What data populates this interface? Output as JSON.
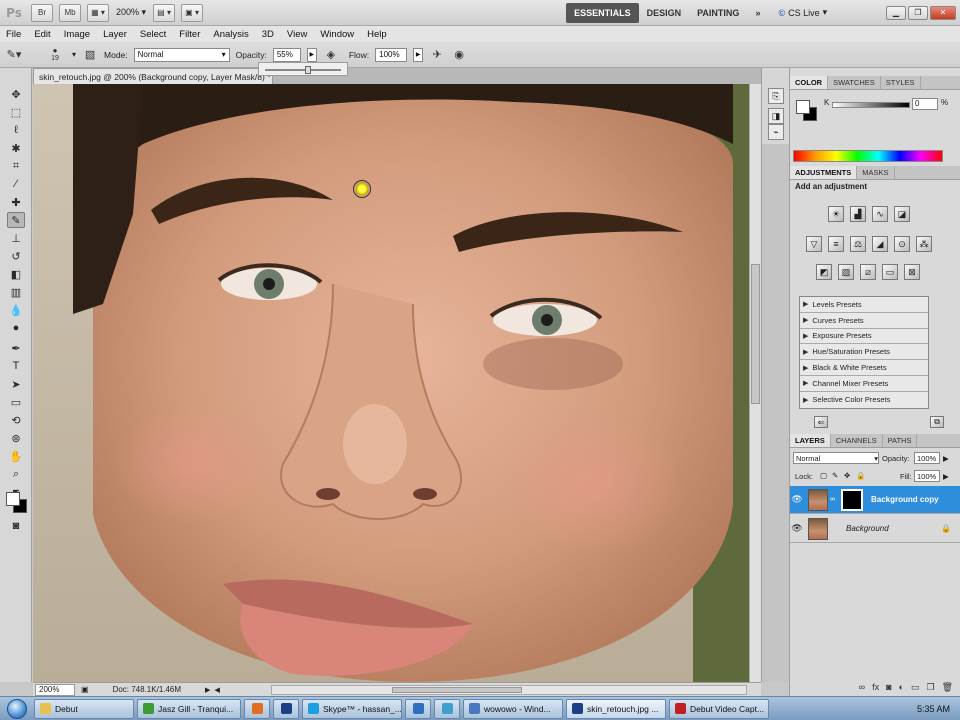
{
  "app": {
    "logo": "Ps",
    "bridge": "Br",
    "minibridge": "Mb",
    "zoom": "200%",
    "workspaces": [
      "ESSENTIALS",
      "DESIGN",
      "PAINTING"
    ],
    "more": "»",
    "cs_live": "CS Live"
  },
  "menu": [
    "File",
    "Edit",
    "Image",
    "Layer",
    "Select",
    "Filter",
    "Analysis",
    "3D",
    "View",
    "Window",
    "Help"
  ],
  "options": {
    "brush_size": "19",
    "mode_label": "Mode:",
    "mode_value": "Normal",
    "opacity_label": "Opacity:",
    "opacity_value": "55%",
    "flow_label": "Flow:",
    "flow_value": "100%",
    "opacity_slider": 0.55
  },
  "document": {
    "tab_title": "skin_retouch.jpg @ 200% (Background copy, Layer Mask/8) *",
    "status_zoom": "200%",
    "status_doc": "Doc: 748.1K/1.46M"
  },
  "color_panel": {
    "tabs": [
      "COLOR",
      "SWATCHES",
      "STYLES"
    ],
    "channel": "K",
    "value": "0",
    "unit": "%"
  },
  "adjustments_panel": {
    "tabs": [
      "ADJUSTMENTS",
      "MASKS"
    ],
    "heading": "Add an adjustment",
    "presets": [
      "Levels Presets",
      "Curves Presets",
      "Exposure Presets",
      "Hue/Saturation Presets",
      "Black & White Presets",
      "Channel Mixer Presets",
      "Selective Color Presets"
    ]
  },
  "layers_panel": {
    "tabs": [
      "LAYERS",
      "CHANNELS",
      "PATHS"
    ],
    "blend_mode": "Normal",
    "opacity_label": "Opacity:",
    "opacity_value": "100%",
    "lock_label": "Lock:",
    "fill_label": "Fill:",
    "fill_value": "100%",
    "layers": [
      {
        "name": "Background copy",
        "selected": true
      },
      {
        "name": "Background",
        "selected": false
      }
    ]
  },
  "taskbar": {
    "items": [
      {
        "label": "Debut",
        "color": "#e8c050"
      },
      {
        "label": "Jasz Gill - Tranqui...",
        "color": "#3d9b35"
      },
      {
        "label": "",
        "color": "#e07020"
      },
      {
        "label": "",
        "color": "#1c3f86"
      },
      {
        "label": "Skype™ - hassan_...",
        "color": "#1aa0e0"
      },
      {
        "label": "",
        "color": "#2f6fc0"
      },
      {
        "label": "",
        "color": "#3fa0d0"
      },
      {
        "label": "wowowo - Wind...",
        "color": "#4a78c0"
      },
      {
        "label": "skin_retouch.jpg ...",
        "color": "#1c3f86"
      },
      {
        "label": "Debut Video Capt...",
        "color": "#c02020"
      }
    ],
    "clock": "5:35 AM"
  }
}
